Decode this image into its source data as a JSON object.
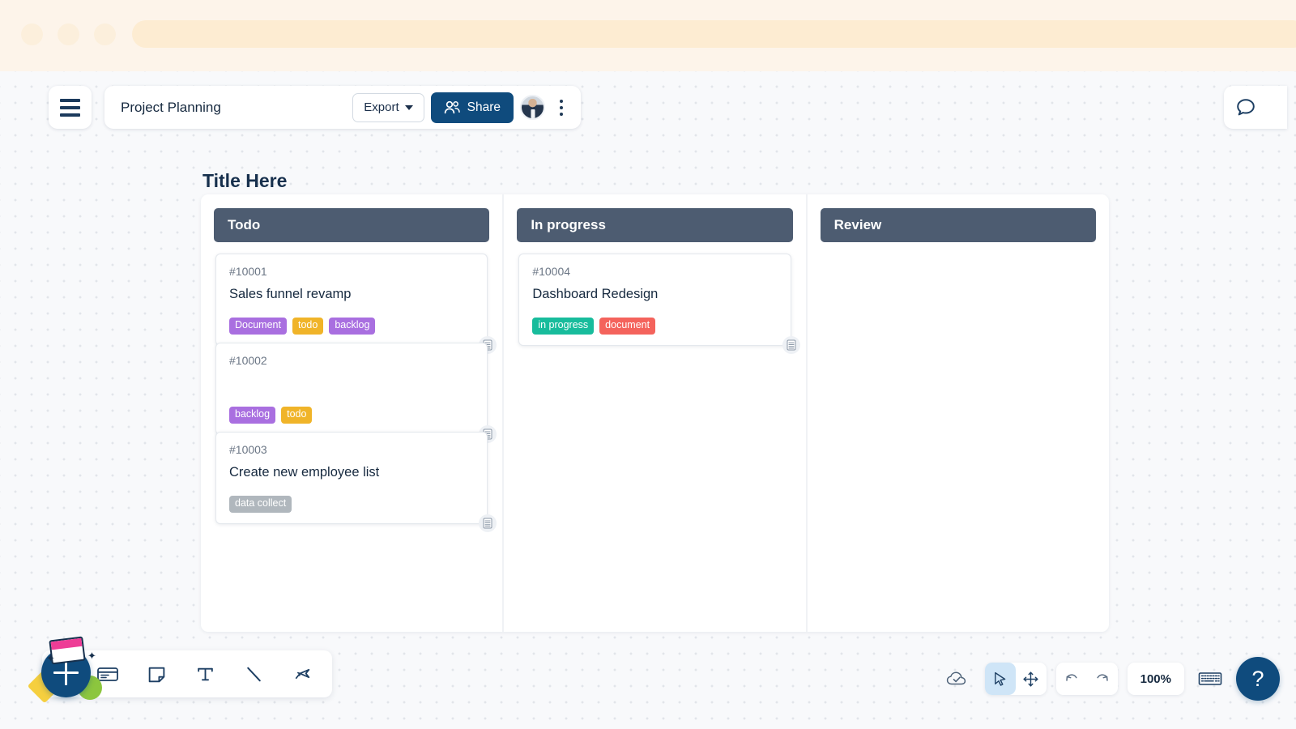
{
  "browser": {
    "dots": [
      "window-dot-red",
      "window-dot-yellow",
      "window-dot-green"
    ]
  },
  "topbar": {
    "menu_icon": "hamburger-menu-icon",
    "board_title": "Project Planning",
    "export_label": "Export",
    "export_caret_icon": "chevron-down-icon",
    "share_label": "Share",
    "share_icon": "people-icon",
    "avatar_name": "user-avatar",
    "more_icon": "kebab-menu-icon",
    "comment_icon": "comment-bubble-icon"
  },
  "board": {
    "heading": "Title Here",
    "columns": [
      {
        "name": "Todo",
        "cards": [
          {
            "id": "#10001",
            "title": "Sales funnel revamp",
            "tags": [
              {
                "label": "Document",
                "color": "#a96fe0"
              },
              {
                "label": "todo",
                "color": "#f0b429"
              },
              {
                "label": "backlog",
                "color": "#a96fe0"
              }
            ],
            "icon": "database-icon"
          },
          {
            "id": "#10002",
            "title": "",
            "tags": [
              {
                "label": "backlog",
                "color": "#a96fe0"
              },
              {
                "label": "todo",
                "color": "#f0b429"
              }
            ],
            "icon": "database-icon"
          },
          {
            "id": "#10003",
            "title": "Create new employee list",
            "tags": [
              {
                "label": "data collect",
                "color": "#b0b7bd"
              }
            ],
            "icon": "database-icon"
          }
        ]
      },
      {
        "name": "In progress",
        "cards": [
          {
            "id": "#10004",
            "title": "Dashboard Redesign",
            "tags": [
              {
                "label": "in progress",
                "color": "#18bc9c"
              },
              {
                "label": "document",
                "color": "#f4635c"
              }
            ],
            "icon": "database-icon"
          }
        ]
      },
      {
        "name": "Review",
        "cards": []
      }
    ]
  },
  "toolbar": {
    "add_icon": "plus-icon",
    "tools": [
      {
        "name": "shape-rectangle-tool",
        "icon": "square-icon"
      },
      {
        "name": "card-tool",
        "icon": "card-icon"
      },
      {
        "name": "sticky-note-tool",
        "icon": "sticky-note-icon"
      },
      {
        "name": "text-tool",
        "icon": "text-t-icon"
      },
      {
        "name": "line-tool",
        "icon": "diagonal-line-icon"
      },
      {
        "name": "marker-tool",
        "icon": "highlighter-pen-icon"
      }
    ]
  },
  "statusbar": {
    "cloud_icon": "cloud-saved-icon",
    "select_icon": "cursor-arrow-icon",
    "pan_icon": "move-arrows-icon",
    "undo_icon": "undo-arrow-icon",
    "redo_icon": "redo-arrow-icon",
    "zoom_level": "100%",
    "keyboard_icon": "keyboard-icon",
    "help_label": "?"
  }
}
